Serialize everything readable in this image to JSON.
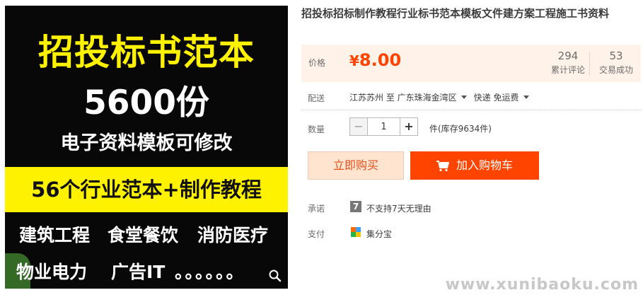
{
  "hero": {
    "line1": "招投标书范本",
    "line2": "5600份",
    "line3": "电子资料模板可修改",
    "band": "56个行业范本+制作教程",
    "row4": [
      "建筑工程",
      "食堂餐饮",
      "消防医疗"
    ],
    "row5": [
      "物业电力",
      "广告IT",
      "。。。。。。"
    ]
  },
  "product": {
    "title": "招投标招标制作教程行业标书范本模板文件建方案工程施工书资料"
  },
  "price": {
    "label": "价格",
    "currency": "¥",
    "value": "8.00",
    "reviews_count": "294",
    "reviews_label": "累计评论",
    "deals_count": "53",
    "deals_label": "交易成功"
  },
  "shipping": {
    "label": "配送",
    "from": "江苏苏州 至",
    "to": "广东珠海金湾区",
    "method": "快递 免运费"
  },
  "quantity": {
    "label": "数量",
    "value": "1",
    "minus": "−",
    "plus": "+",
    "stock": "件(库存9634件)"
  },
  "actions": {
    "buy_now": "立即购买",
    "add_to_cart": "加入购物车"
  },
  "promise": {
    "label": "承诺",
    "icon_text": "7",
    "text": "不支持7天无理由"
  },
  "payment": {
    "label": "支付",
    "text": "集分宝"
  },
  "watermark": "www.xunibaoku.com",
  "colors": {
    "accent": "#ff4400",
    "price_bg": "#fff2e8",
    "hero_yellow": "#fff200"
  }
}
